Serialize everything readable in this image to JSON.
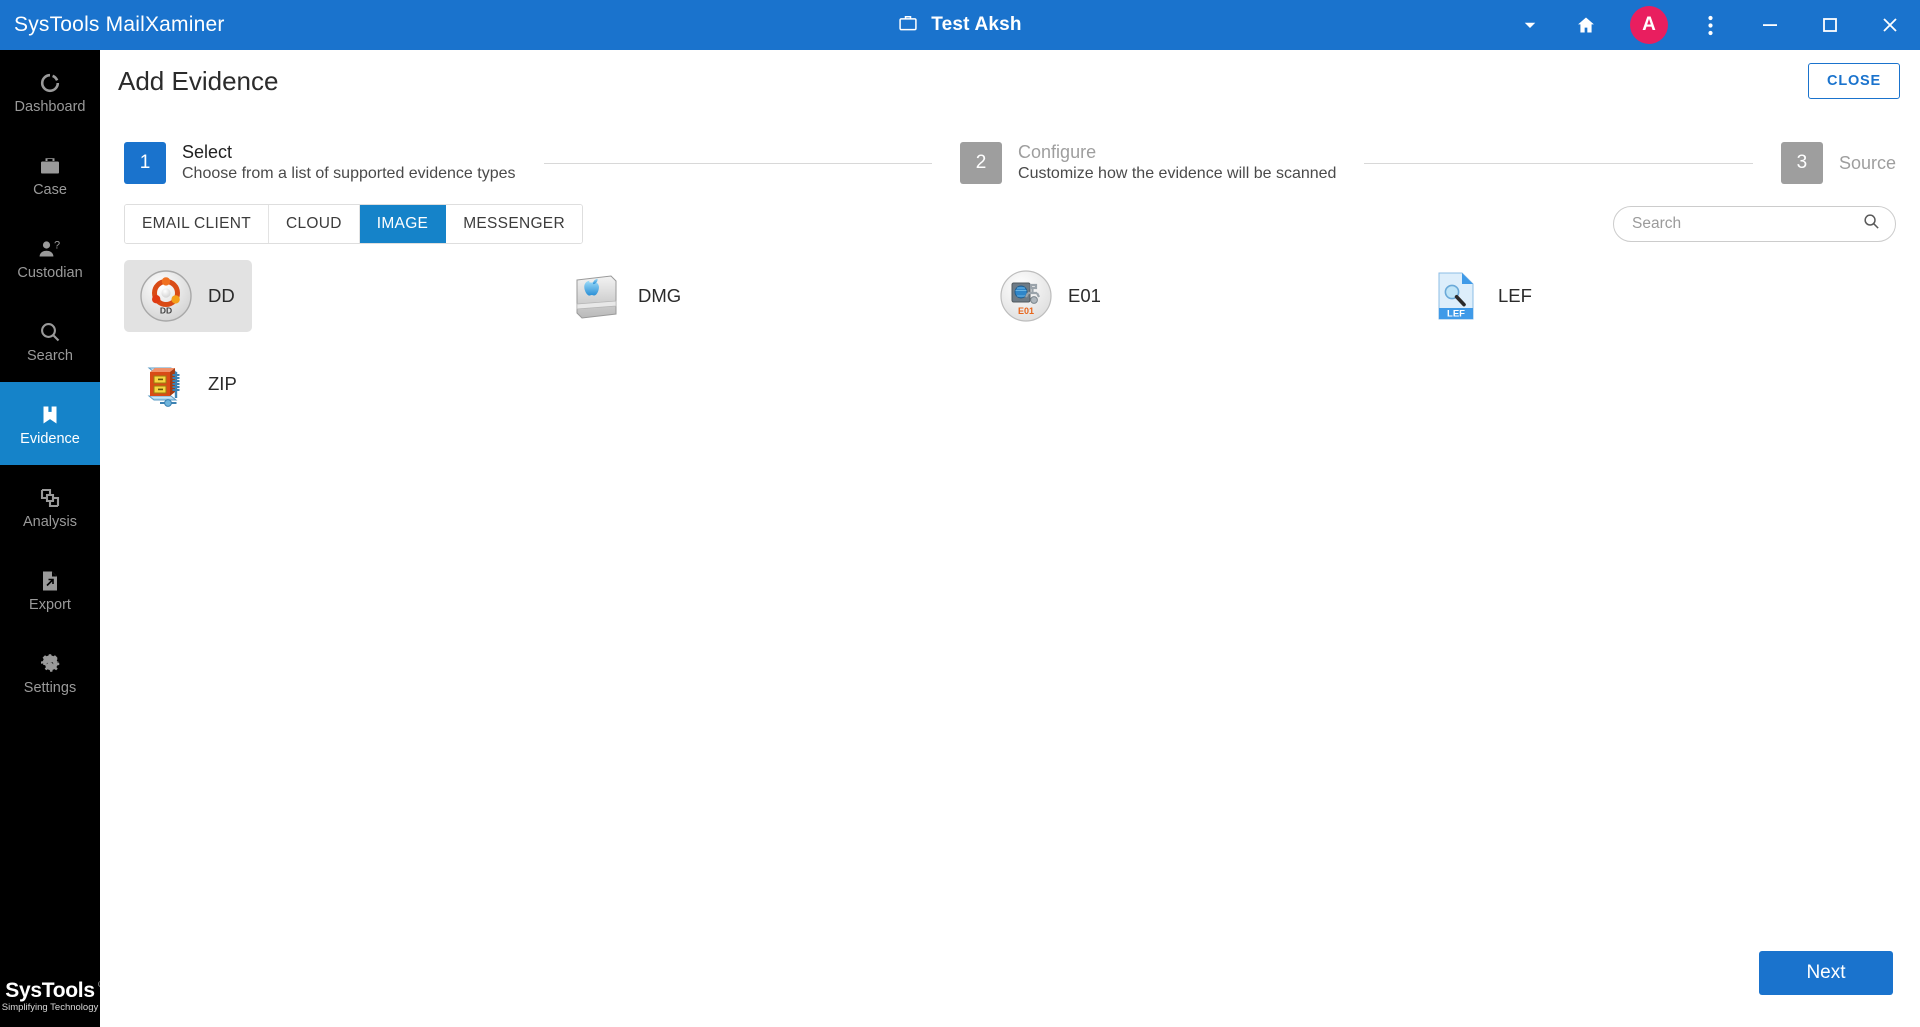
{
  "titlebar": {
    "app_title": "SysTools MailXaminer",
    "case_icon": "briefcase-icon",
    "case_name": "Test Aksh",
    "dropdown_icon": "chevron-down-icon",
    "home_icon": "home-icon",
    "avatar_initial": "A",
    "menu_icon": "kebab-menu-icon",
    "minimize_icon": "minimize-icon",
    "maximize_icon": "maximize-icon",
    "close_icon": "close-icon",
    "bg_color": "#1a73cd",
    "avatar_color": "#e91e5f"
  },
  "sidebar": {
    "bg_color": "#000000",
    "active_color": "#1583c9",
    "items": [
      {
        "label": "Dashboard",
        "icon": "dashboard-icon",
        "active": false
      },
      {
        "label": "Case",
        "icon": "briefcase-icon",
        "active": false
      },
      {
        "label": "Custodian",
        "icon": "person-question-icon",
        "active": false
      },
      {
        "label": "Search",
        "icon": "search-icon",
        "active": false
      },
      {
        "label": "Evidence",
        "icon": "bookmark-icon",
        "active": true
      },
      {
        "label": "Analysis",
        "icon": "layers-icon",
        "active": false
      },
      {
        "label": "Export",
        "icon": "file-export-icon",
        "active": false
      },
      {
        "label": "Settings",
        "icon": "gear-icon",
        "active": false
      }
    ],
    "brand": {
      "name": "SysTools",
      "registered": "®",
      "tagline": "Simplifying Technology"
    }
  },
  "page": {
    "title": "Add Evidence",
    "close_label": "CLOSE"
  },
  "stepper": {
    "steps": [
      {
        "number": "1",
        "title": "Select",
        "desc": "Choose from a list of supported evidence types",
        "state": "active"
      },
      {
        "number": "2",
        "title": "Configure",
        "desc": "Customize how the evidence will be scanned",
        "state": "idle"
      },
      {
        "number": "3",
        "title": "Source",
        "desc": "",
        "state": "idle"
      }
    ]
  },
  "tabs": [
    {
      "label": "EMAIL CLIENT",
      "active": false
    },
    {
      "label": "CLOUD",
      "active": false
    },
    {
      "label": "IMAGE",
      "active": true
    },
    {
      "label": "MESSENGER",
      "active": false
    }
  ],
  "search": {
    "placeholder": "Search",
    "value": "",
    "icon": "search-icon"
  },
  "evidence_types": [
    {
      "label": "DD",
      "icon": "ubuntu-dd-icon",
      "selected": true
    },
    {
      "label": "DMG",
      "icon": "apple-disk-icon",
      "selected": false
    },
    {
      "label": "E01",
      "icon": "e01-disk-icon",
      "selected": false
    },
    {
      "label": "LEF",
      "icon": "lef-file-icon",
      "selected": false
    },
    {
      "label": "ZIP",
      "icon": "winzip-icon",
      "selected": false
    }
  ],
  "footer": {
    "next_label": "Next"
  }
}
